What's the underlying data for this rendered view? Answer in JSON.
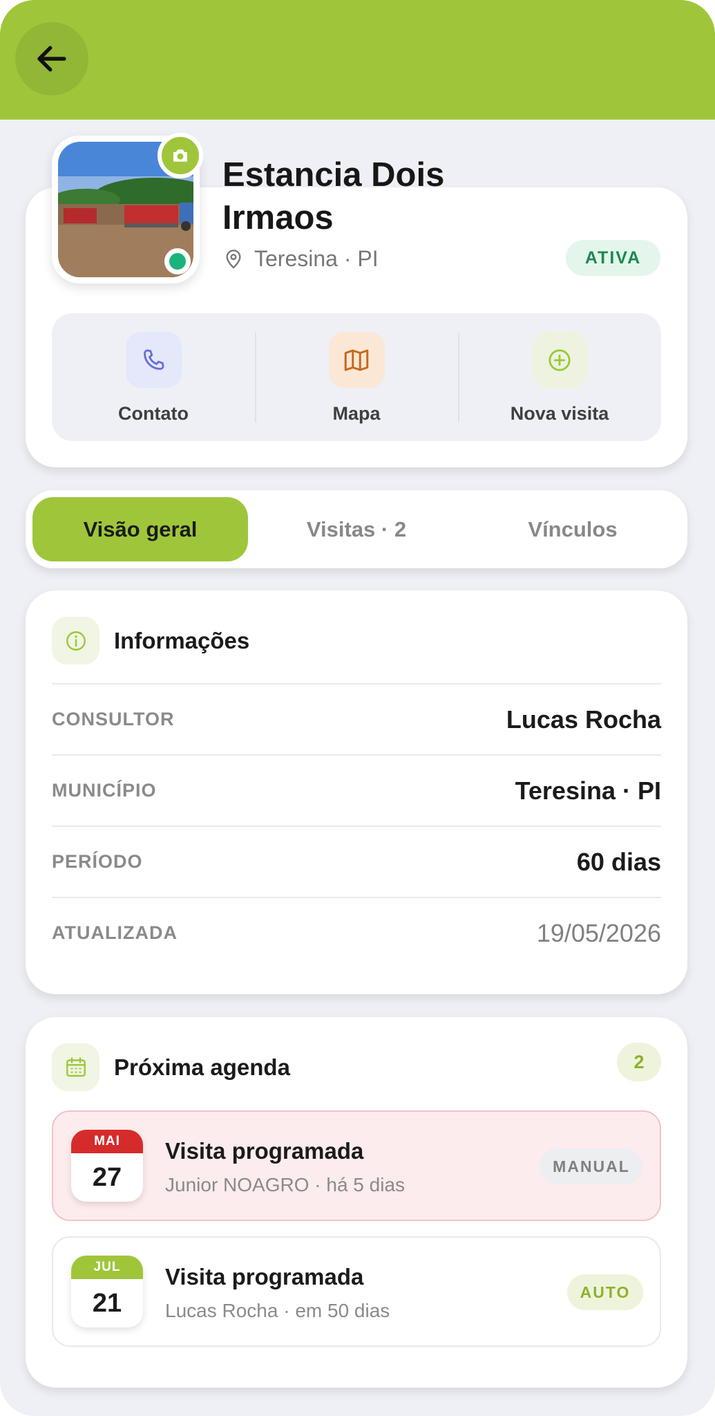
{
  "icons": {
    "back": "arrow-left-icon",
    "camera": "camera-icon",
    "location": "map-pin-icon",
    "phone": "phone-icon",
    "map": "map-icon",
    "add": "plus-circle-icon",
    "info": "info-icon",
    "calendar": "calendar-icon"
  },
  "colors": {
    "brand": "#9fc63a",
    "background": "#eff0f5",
    "online": "#18b47b",
    "status_active_bg": "#e4f5ec",
    "status_active_text": "#1b8a4f",
    "urgent_bg": "#fdeced",
    "urgent_month": "#d62b2b"
  },
  "farm": {
    "name": "Estancia Dois Irmaos",
    "location": "Teresina · PI",
    "status": "ATIVA"
  },
  "actions": [
    {
      "label": "Contato",
      "icon": "phone-icon"
    },
    {
      "label": "Mapa",
      "icon": "map-icon"
    },
    {
      "label": "Nova visita",
      "icon": "plus-circle-icon"
    }
  ],
  "tabs": [
    {
      "label": "Visão geral",
      "active": true
    },
    {
      "label": "Visitas · 2",
      "active": false
    },
    {
      "label": "Vínculos",
      "active": false
    }
  ],
  "info": {
    "title": "Informações",
    "rows": [
      {
        "label": "CONSULTOR",
        "value": "Lucas Rocha"
      },
      {
        "label": "MUNICÍPIO",
        "value": "Teresina · PI"
      },
      {
        "label": "PERÍODO",
        "value": "60 dias"
      },
      {
        "label": "ATUALIZADA",
        "value": "19/05/2026"
      }
    ]
  },
  "agenda": {
    "title": "Próxima agenda",
    "count": "2",
    "events": [
      {
        "month": "MAI",
        "day": "27",
        "title": "Visita programada",
        "subtitle": "Junior NOAGRO · há 5 dias",
        "tag": "MANUAL",
        "urgent": true
      },
      {
        "month": "JUL",
        "day": "21",
        "title": "Visita programada",
        "subtitle": "Lucas Rocha · em 50 dias",
        "tag": "AUTO",
        "urgent": false
      }
    ]
  }
}
